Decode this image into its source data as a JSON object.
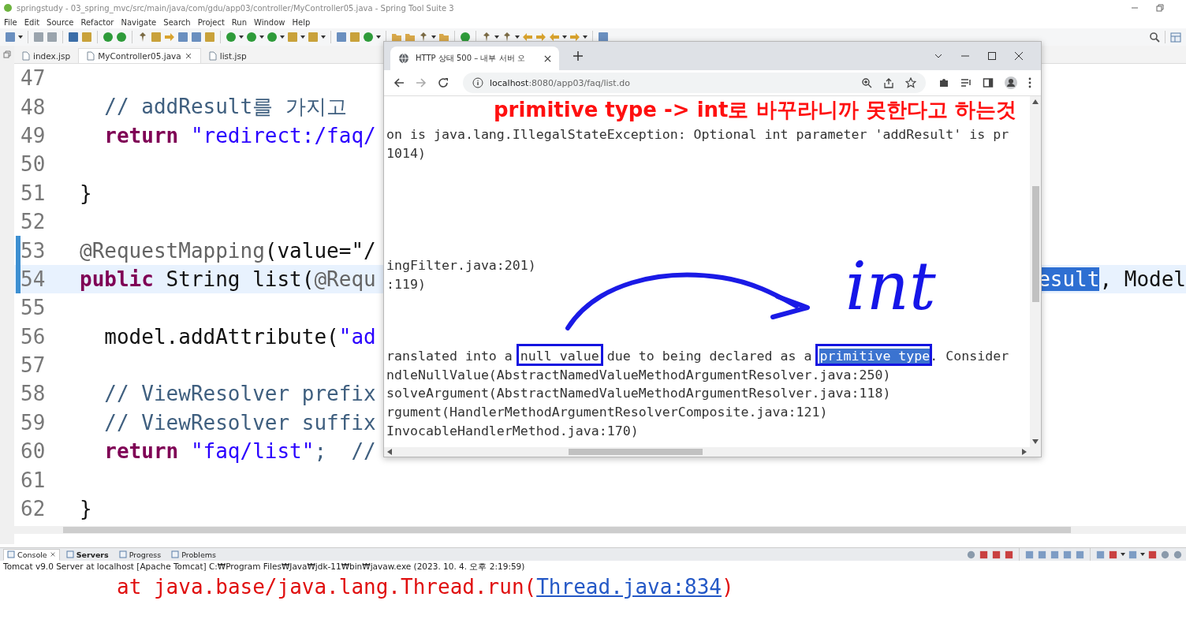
{
  "window": {
    "title": "springstudy - 03_spring_mvc/src/main/java/com/gdu/app03/controller/MyController05.java - Spring Tool Suite 3"
  },
  "menu": [
    "File",
    "Edit",
    "Source",
    "Refactor",
    "Navigate",
    "Search",
    "Project",
    "Run",
    "Window",
    "Help"
  ],
  "editor_tabs": [
    {
      "label": "index.jsp",
      "selected": false,
      "closable": false
    },
    {
      "label": "MyController05.java",
      "selected": true,
      "closable": true
    },
    {
      "label": "list.jsp",
      "selected": false,
      "closable": false
    }
  ],
  "code_lines": [
    {
      "number": "47",
      "current": false,
      "changed": false
    },
    {
      "number": "48",
      "current": false,
      "changed": false,
      "parts": [
        {
          "text": "  // addResult를 가지고",
          "kind": "comment"
        }
      ]
    },
    {
      "number": "49",
      "current": false,
      "changed": false,
      "parts": [
        {
          "text": "  return ",
          "kind": "keyword"
        },
        {
          "text": "\"redirect:/faq/",
          "kind": "string"
        }
      ]
    },
    {
      "number": "50",
      "current": false,
      "changed": false
    },
    {
      "number": "51",
      "current": false,
      "changed": false,
      "parts": [
        {
          "text": "}",
          "kind": "plain"
        }
      ]
    },
    {
      "number": "52",
      "current": false,
      "changed": false
    },
    {
      "number": "53",
      "current": false,
      "changed": true,
      "parts": [
        {
          "text": "@RequestMapping",
          "kind": "annotation"
        },
        {
          "text": "(value=\"/",
          "kind": "plain"
        }
      ]
    },
    {
      "number": "54",
      "current": true,
      "changed": true,
      "parts": [
        {
          "text": "public ",
          "kind": "keyword"
        },
        {
          "text": "String list(",
          "kind": "plain"
        },
        {
          "text": "@Requ",
          "kind": "annotation"
        }
      ],
      "tail": [
        {
          "text": "esult",
          "kind": "plain",
          "selected": true
        },
        {
          "text": ", Model",
          "kind": "plain",
          "selected": false
        }
      ]
    },
    {
      "number": "55",
      "current": false,
      "changed": false
    },
    {
      "number": "56",
      "current": false,
      "changed": false,
      "parts": [
        {
          "text": "  model.addAttribute(",
          "kind": "plain"
        },
        {
          "text": "\"ad",
          "kind": "string"
        }
      ]
    },
    {
      "number": "57",
      "current": false,
      "changed": false
    },
    {
      "number": "58",
      "current": false,
      "changed": false,
      "parts": [
        {
          "text": "  // ViewResolver prefix",
          "kind": "comment"
        }
      ]
    },
    {
      "number": "59",
      "current": false,
      "changed": false,
      "parts": [
        {
          "text": "  // ViewResolver suffix",
          "kind": "comment"
        }
      ]
    },
    {
      "number": "60",
      "current": false,
      "changed": false,
      "parts": [
        {
          "text": "  return ",
          "kind": "keyword"
        },
        {
          "text": "\"faq/list\"",
          "kind": "string"
        },
        {
          "text": ";  //",
          "kind": "comment"
        }
      ]
    },
    {
      "number": "61",
      "current": false,
      "changed": false
    },
    {
      "number": "62",
      "current": false,
      "changed": false,
      "parts": [
        {
          "text": "}",
          "kind": "plain"
        }
      ]
    }
  ],
  "browser": {
    "tab_title": "HTTP 상태 500 – 내부 서버 오",
    "url_host": "localhost",
    "url_path": ":8080/app03/faq/list.do",
    "blocks": [
      [
        {
          "parts": [
            {
              "text": "on is java.lang.IllegalStateException: Optional int parameter 'addResult' is pr",
              "selected": false
            }
          ]
        },
        {
          "parts": [
            {
              "text": "1014)",
              "selected": false
            }
          ]
        }
      ],
      [
        {
          "parts": [
            {
              "text": "ingFilter.java:201)",
              "selected": false
            }
          ]
        },
        {
          "parts": [
            {
              "text": ":119)",
              "selected": false
            }
          ]
        }
      ],
      [
        {
          "parts": [
            {
              "text": "ranslated into a null value due to being declared as a ",
              "selected": false
            },
            {
              "text": "primitive type",
              "selected": true
            },
            {
              "text": ". Consider",
              "selected": false
            }
          ]
        },
        {
          "parts": [
            {
              "text": "ndleNullValue(AbstractNamedValueMethodArgumentResolver.java:250)",
              "selected": false
            }
          ]
        },
        {
          "parts": [
            {
              "text": "solveArgument(AbstractNamedValueMethodArgumentResolver.java:118)",
              "selected": false
            }
          ]
        },
        {
          "parts": [
            {
              "text": "rgument(HandlerMethodArgumentResolverComposite.java:121)",
              "selected": false
            }
          ]
        },
        {
          "parts": [
            {
              "text": "InvocableHandlerMethod.java:170)",
              "selected": false
            }
          ]
        }
      ]
    ]
  },
  "annotations": {
    "note": "primitive type -> int로 바꾸라니까 못한다고 하는것",
    "handwriting": "int"
  },
  "console": {
    "tabs": [
      {
        "label": "Console",
        "selected": true,
        "closable": true,
        "highlighted": false
      },
      {
        "label": "Servers",
        "selected": false,
        "closable": false,
        "highlighted": true
      },
      {
        "label": "Progress",
        "selected": false,
        "closable": false,
        "highlighted": false
      },
      {
        "label": "Problems",
        "selected": false,
        "closable": false,
        "highlighted": false
      }
    ],
    "process": "Tomcat v9.0 Server at localhost [Apache Tomcat] C:₩Program Files₩Java₩jdk-11₩bin₩javaw.exe  (2023. 10. 4. 오후 2:19:59)",
    "output": {
      "before": "at java.base/java.lang.Thread.run(",
      "link": "Thread.java:834",
      "after": ")"
    }
  }
}
